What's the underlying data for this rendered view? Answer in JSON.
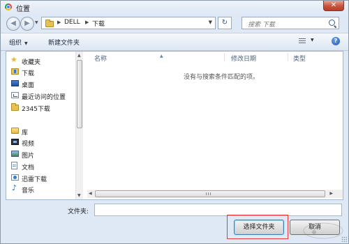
{
  "window": {
    "title": "位置",
    "close_glyph": "✕"
  },
  "address": {
    "breadcrumbs": [
      "DELL",
      "下载"
    ],
    "search_placeholder": "搜索 下载"
  },
  "toolbar": {
    "organize": "组织",
    "new_folder": "新建文件夹"
  },
  "nav": {
    "favorites_header": "收藏夹",
    "favorites": [
      {
        "label": "下载",
        "icon": "download-folder-icon"
      },
      {
        "label": "桌面",
        "icon": "desktop-icon"
      },
      {
        "label": "最近访问的位置",
        "icon": "recent-places-icon"
      },
      {
        "label": "2345下载",
        "icon": "folder-icon"
      }
    ],
    "libraries_header": "库",
    "libraries": [
      {
        "label": "视频",
        "icon": "video-icon"
      },
      {
        "label": "图片",
        "icon": "pictures-icon"
      },
      {
        "label": "文档",
        "icon": "documents-icon"
      },
      {
        "label": "迅雷下载",
        "icon": "thunder-download-icon"
      },
      {
        "label": "音乐",
        "icon": "music-icon"
      }
    ]
  },
  "content": {
    "columns": [
      "名称",
      "修改日期",
      "类型"
    ],
    "empty_message": "没有与搜索条件匹配的项。"
  },
  "footer": {
    "folder_label": "文件夹:",
    "folder_value": "",
    "select_button": "选择文件夹",
    "cancel_button": "取消"
  },
  "watermark": {
    "text": "Baidu"
  },
  "colors": {
    "highlight": "#e03a3a",
    "close_button": "#c7533d",
    "window_frame": "#dfe8f5"
  }
}
